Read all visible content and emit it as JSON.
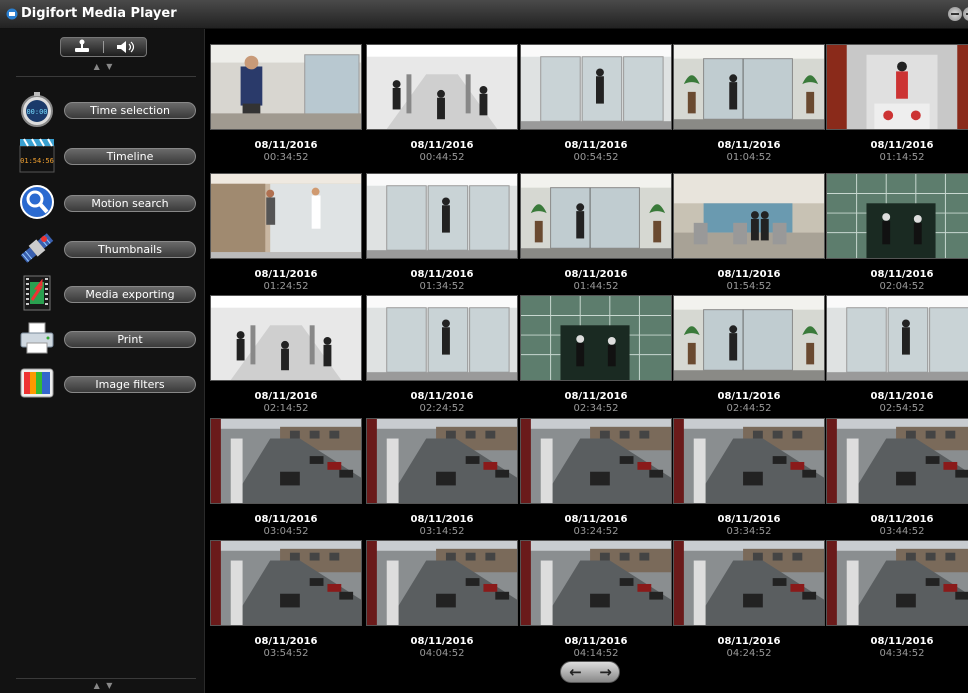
{
  "window": {
    "title": "Digifort Media Player"
  },
  "sidebar": {
    "top_arrows": "▲ ▼",
    "bottom_arrows": "▲ ▼",
    "items": [
      {
        "label": "Time selection",
        "icon": "stopwatch-icon"
      },
      {
        "label": "Timeline",
        "icon": "clapper-icon",
        "icon_text": "01:54:56"
      },
      {
        "label": "Motion search",
        "icon": "magnifier-icon"
      },
      {
        "label": "Thumbnails",
        "icon": "satellite-icon"
      },
      {
        "label": "Media exporting",
        "icon": "film-export-icon"
      },
      {
        "label": "Print",
        "icon": "printer-icon"
      },
      {
        "label": "Image filters",
        "icon": "color-palette-icon"
      }
    ]
  },
  "thumbnails": [
    {
      "date": "08/11/2016",
      "time": "00:34:52",
      "scene": "office-person"
    },
    {
      "date": "08/11/2016",
      "time": "00:44:52",
      "scene": "turnstile"
    },
    {
      "date": "08/11/2016",
      "time": "00:54:52",
      "scene": "glass-door"
    },
    {
      "date": "08/11/2016",
      "time": "01:04:52",
      "scene": "plant-door"
    },
    {
      "date": "08/11/2016",
      "time": "01:14:52",
      "scene": "elevator"
    },
    {
      "date": "08/11/2016",
      "time": "01:24:52",
      "scene": "corridor-woman"
    },
    {
      "date": "08/11/2016",
      "time": "01:34:52",
      "scene": "glass-door"
    },
    {
      "date": "08/11/2016",
      "time": "01:44:52",
      "scene": "plant-door"
    },
    {
      "date": "08/11/2016",
      "time": "01:54:52",
      "scene": "lobby"
    },
    {
      "date": "08/11/2016",
      "time": "02:04:52",
      "scene": "green-glass"
    },
    {
      "date": "08/11/2016",
      "time": "02:14:52",
      "scene": "turnstile"
    },
    {
      "date": "08/11/2016",
      "time": "02:24:52",
      "scene": "glass-door"
    },
    {
      "date": "08/11/2016",
      "time": "02:34:52",
      "scene": "green-glass"
    },
    {
      "date": "08/11/2016",
      "time": "02:44:52",
      "scene": "plant-door"
    },
    {
      "date": "08/11/2016",
      "time": "02:54:52",
      "scene": "glass-door"
    },
    {
      "date": "08/11/2016",
      "time": "03:04:52",
      "scene": "street"
    },
    {
      "date": "08/11/2016",
      "time": "03:14:52",
      "scene": "street"
    },
    {
      "date": "08/11/2016",
      "time": "03:24:52",
      "scene": "street"
    },
    {
      "date": "08/11/2016",
      "time": "03:34:52",
      "scene": "street"
    },
    {
      "date": "08/11/2016",
      "time": "03:44:52",
      "scene": "street"
    },
    {
      "date": "08/11/2016",
      "time": "03:54:52",
      "scene": "street"
    },
    {
      "date": "08/11/2016",
      "time": "04:04:52",
      "scene": "street"
    },
    {
      "date": "08/11/2016",
      "time": "04:14:52",
      "scene": "street"
    },
    {
      "date": "08/11/2016",
      "time": "04:24:52",
      "scene": "street"
    },
    {
      "date": "08/11/2016",
      "time": "04:34:52",
      "scene": "street"
    }
  ],
  "pager": {
    "prev": "←",
    "next": "→"
  }
}
